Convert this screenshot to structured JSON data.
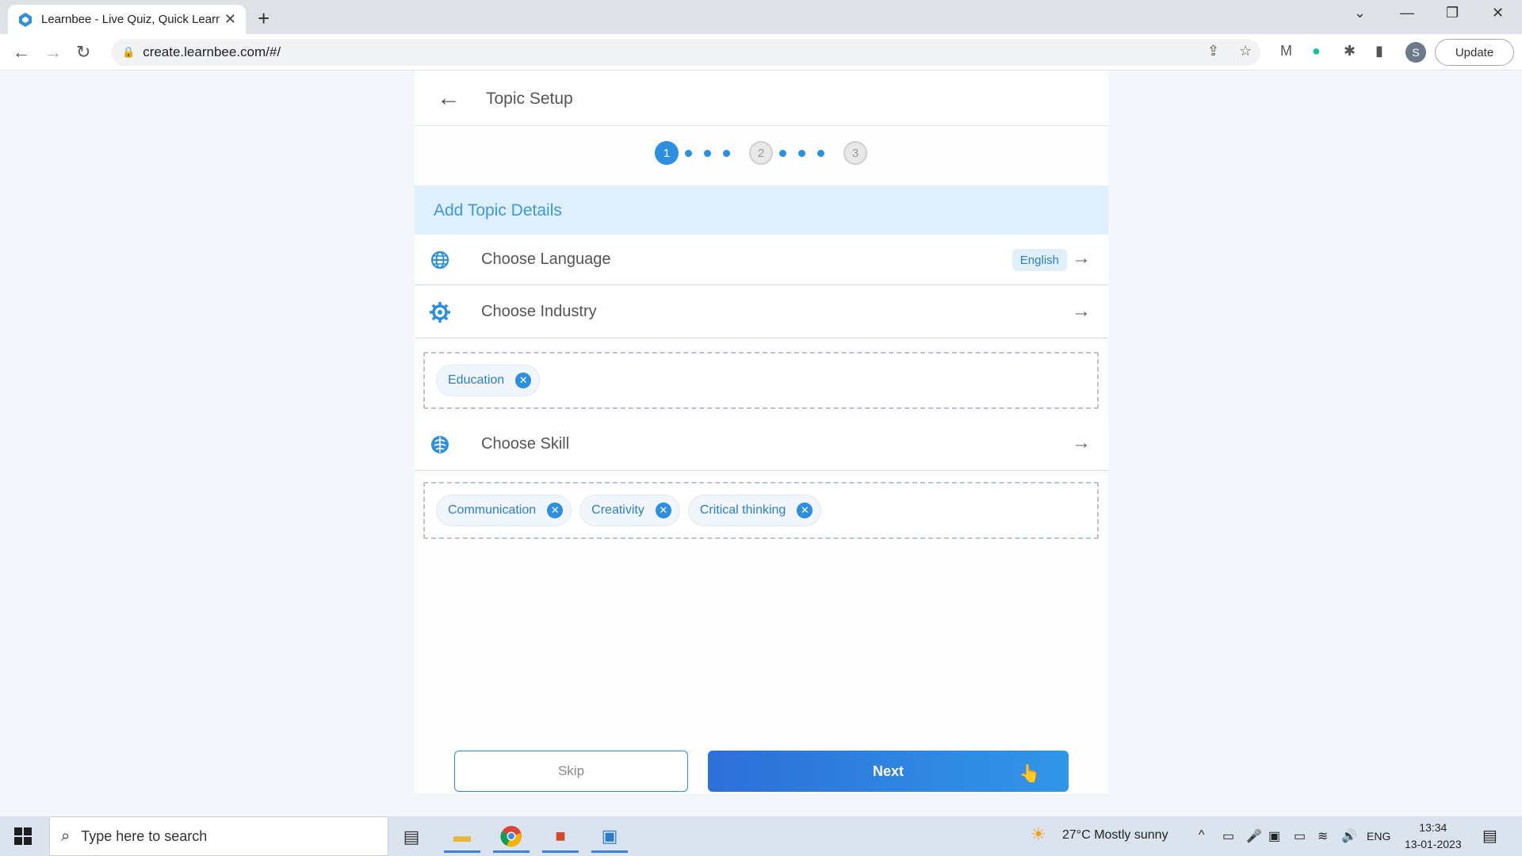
{
  "browser": {
    "tab_title": "Learnbee - Live Quiz, Quick Learn",
    "url": "create.learnbee.com/#/",
    "profile_initial": "S",
    "update_label": "Update"
  },
  "header": {
    "title": "Topic Setup"
  },
  "stepper": {
    "steps": [
      "1",
      "2",
      "3"
    ]
  },
  "section": {
    "title": "Add Topic Details"
  },
  "rows": {
    "language": {
      "label": "Choose Language",
      "value": "English"
    },
    "industry": {
      "label": "Choose Industry"
    },
    "skill": {
      "label": "Choose Skill"
    }
  },
  "industry_chips": [
    "Education"
  ],
  "skill_chips": [
    "Communication",
    "Creativity",
    "Critical thinking"
  ],
  "buttons": {
    "skip": "Skip",
    "next": "Next"
  },
  "taskbar": {
    "search_placeholder": "Type here to search",
    "weather": "27°C  Mostly sunny",
    "lang": "ENG",
    "time": "13:34",
    "date": "13-01-2023"
  },
  "colors": {
    "accent": "#2d8fe0",
    "section_bg": "#dff0fc"
  }
}
